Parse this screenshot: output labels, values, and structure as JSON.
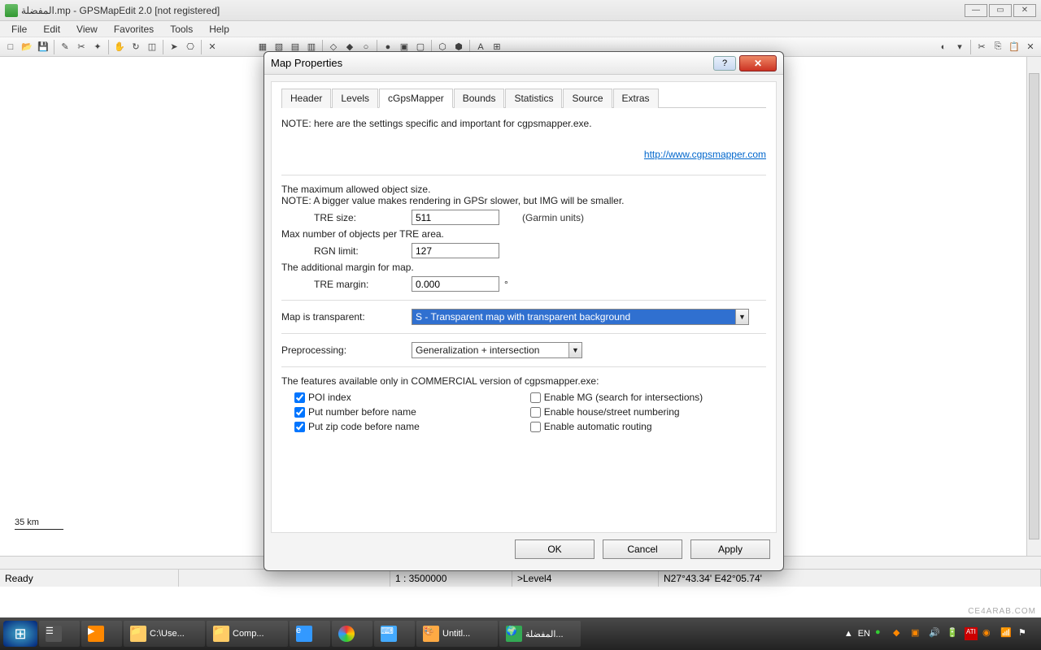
{
  "window": {
    "title": "المفضلة.mp - GPSMapEdit 2.0 [not registered]"
  },
  "menu": [
    "File",
    "Edit",
    "View",
    "Favorites",
    "Tools",
    "Help"
  ],
  "canvas": {
    "scale_label": "35 km"
  },
  "statusbar": {
    "ready": "Ready",
    "scale": "1 : 3500000",
    "level": ">Level4",
    "coords": "N27°43.34' E42°05.74'"
  },
  "dialog": {
    "title": "Map Properties",
    "tabs": [
      "Header",
      "Levels",
      "cGpsMapper",
      "Bounds",
      "Statistics",
      "Source",
      "Extras"
    ],
    "active_tab": "cGpsMapper",
    "note": "NOTE: here are the settings specific and important for cgpsmapper.exe.",
    "link": "http://www.cgpsmapper.com",
    "obj_size_label": "The maximum allowed object size.",
    "obj_size_note": "NOTE: A bigger value makes rendering in GPSr slower, but IMG will be smaller.",
    "tre_size_label": "TRE size:",
    "tre_size_value": "511",
    "tre_size_unit": "(Garmin units)",
    "max_obj_label": "Max number of objects per TRE area.",
    "rgn_limit_label": "RGN limit:",
    "rgn_limit_value": "127",
    "margin_label": "The additional margin for map.",
    "tre_margin_label": "TRE margin:",
    "tre_margin_value": "0.000",
    "tre_margin_unit": "°",
    "transparent_label": "Map is transparent:",
    "transparent_value": "S - Transparent map with transparent background",
    "preprocessing_label": "Preprocessing:",
    "preprocessing_value": "Generalization + intersection",
    "commercial_label": "The features available only in COMMERCIAL version of cgpsmapper.exe:",
    "check_poi": "POI index",
    "check_number": "Put number before name",
    "check_zip": "Put zip code before name",
    "check_mg": "Enable MG (search for intersections)",
    "check_house": "Enable house/street numbering",
    "check_routing": "Enable automatic routing",
    "btn_ok": "OK",
    "btn_cancel": "Cancel",
    "btn_apply": "Apply"
  },
  "taskbar": {
    "items": [
      "",
      "",
      "C:\\Use...",
      "Comp...",
      "",
      "",
      "",
      "Untitl...",
      "المفضلة..."
    ],
    "lang": "EN"
  },
  "watermark": "CE4ARAB.COM"
}
